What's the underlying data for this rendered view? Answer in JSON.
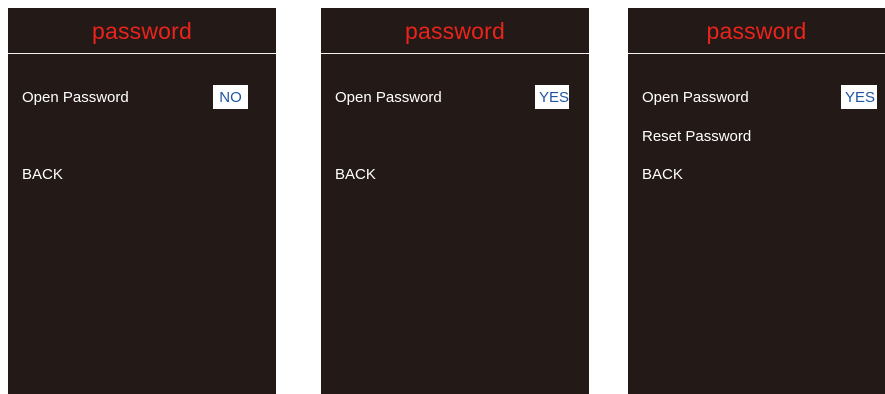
{
  "screens": [
    {
      "title": "password",
      "items": {
        "open_password_label": "Open Password",
        "open_password_value": "NO",
        "back_label": "BACK"
      }
    },
    {
      "title": "password",
      "items": {
        "open_password_label": "Open Password",
        "open_password_value": "YES",
        "back_label": "BACK"
      }
    },
    {
      "title": "password",
      "items": {
        "open_password_label": "Open Password",
        "open_password_value": "YES",
        "reset_password_label": "Reset Password",
        "back_label": "BACK"
      }
    }
  ],
  "colors": {
    "screen_background": "#231916",
    "title_text": "#e8241c",
    "menu_text": "#ffffff",
    "value_background": "#ffffff",
    "value_text": "#1f56a3"
  }
}
